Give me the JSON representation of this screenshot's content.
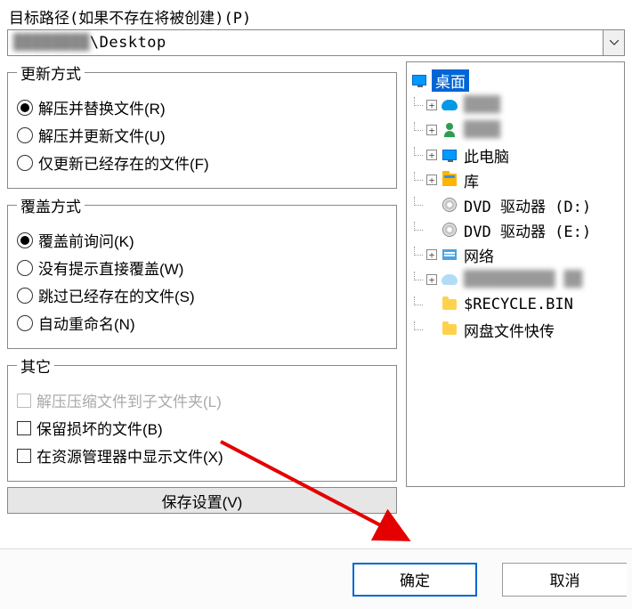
{
  "path": {
    "label": "目标路径(如果不存在将被创建)(P)",
    "value_prefix": "████████",
    "value_suffix": "\\Desktop"
  },
  "groups": {
    "update": {
      "legend": "更新方式",
      "options": [
        {
          "label": "解压并替换文件(R)",
          "selected": true
        },
        {
          "label": "解压并更新文件(U)",
          "selected": false
        },
        {
          "label": "仅更新已经存在的文件(F)",
          "selected": false
        }
      ]
    },
    "overwrite": {
      "legend": "覆盖方式",
      "options": [
        {
          "label": "覆盖前询问(K)",
          "selected": true
        },
        {
          "label": "没有提示直接覆盖(W)",
          "selected": false
        },
        {
          "label": "跳过已经存在的文件(S)",
          "selected": false
        },
        {
          "label": "自动重命名(N)",
          "selected": false
        }
      ]
    },
    "other": {
      "legend": "其它",
      "options": [
        {
          "label": "解压压缩文件到子文件夹(L)",
          "disabled": true
        },
        {
          "label": "保留损坏的文件(B)",
          "disabled": false
        },
        {
          "label": "在资源管理器中显示文件(X)",
          "disabled": false
        }
      ]
    }
  },
  "save_button": "保存设置(V)",
  "tree": {
    "root": "桌面",
    "items": [
      {
        "icon": "cloud",
        "label": "████",
        "expandable": true,
        "blur": true
      },
      {
        "icon": "person",
        "label": "████",
        "expandable": true,
        "blur": true
      },
      {
        "icon": "monitor",
        "label": "此电脑",
        "expandable": true
      },
      {
        "icon": "lib",
        "label": "库",
        "expandable": true
      },
      {
        "icon": "dvd",
        "label": "DVD 驱动器 (D:)",
        "expandable": false
      },
      {
        "icon": "dvd",
        "label": "DVD 驱动器 (E:)",
        "expandable": false
      },
      {
        "icon": "net",
        "label": "网络",
        "expandable": true
      },
      {
        "icon": "cloud-lite",
        "label": "██████████ ██",
        "expandable": true,
        "blur": true
      },
      {
        "icon": "folder",
        "label": "$RECYCLE.BIN",
        "expandable": false
      },
      {
        "icon": "folder",
        "label": "网盘文件快传",
        "expandable": false
      }
    ]
  },
  "buttons": {
    "ok": "确定",
    "cancel": "取消"
  }
}
